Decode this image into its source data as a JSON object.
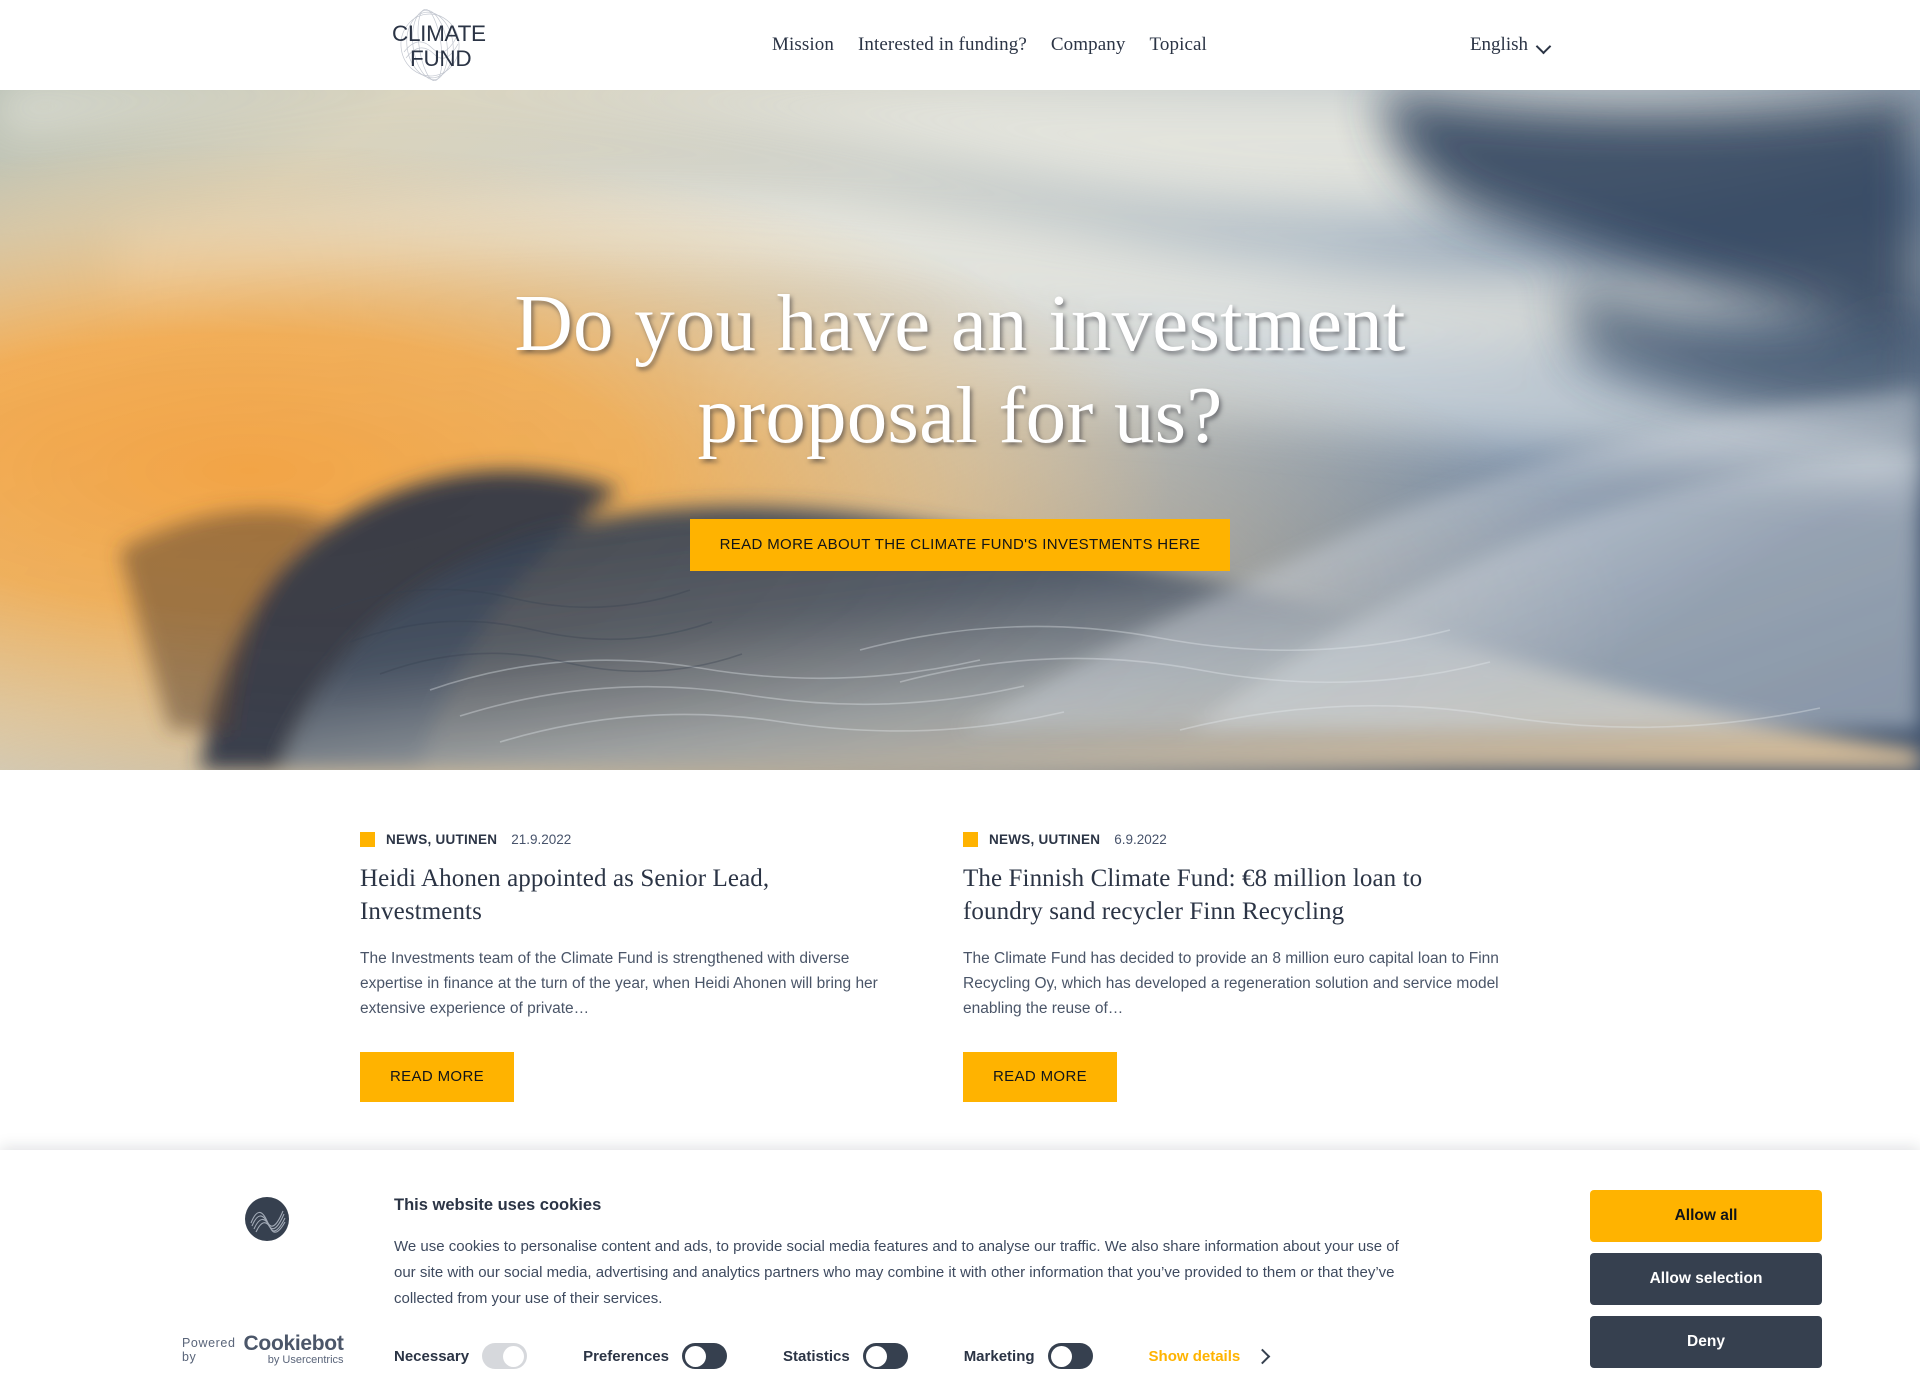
{
  "header": {
    "logo": {
      "line1": "CLIMATE",
      "line2": "FUND",
      "icon": "climate-fund-wave-logo"
    },
    "nav": [
      {
        "label": "Mission"
      },
      {
        "label": "Interested in funding?"
      },
      {
        "label": "Company"
      },
      {
        "label": "Topical"
      }
    ],
    "language": {
      "label": "English",
      "icon": "chevron-down-icon"
    }
  },
  "hero": {
    "title": "Do you have an investment proposal for us?",
    "cta_label": "READ MORE ABOUT THE CLIMATE FUND'S INVESTMENTS HERE",
    "accent_color": "#ffb300"
  },
  "news": [
    {
      "category": "NEWS, UUTINEN",
      "date": "21.9.2022",
      "title": "Heidi Ahonen appointed as Senior Lead, Investments",
      "excerpt": "The Investments team of the Climate Fund is strengthened with diverse expertise in finance at the turn of the year, when Heidi Ahonen will bring her extensive experience of private…",
      "button_label": "READ MORE"
    },
    {
      "category": "NEWS, UUTINEN",
      "date": "6.9.2022",
      "title": "The Finnish Climate Fund: €8 million loan to foundry sand recycler Finn Recycling",
      "excerpt": "The Climate Fund has decided to provide an 8 million euro capital loan to Finn Recycling Oy, which has developed a regeneration solution and service model enabling the reuse of…",
      "button_label": "READ MORE"
    }
  ],
  "cookie_banner": {
    "heading": "This website uses cookies",
    "body": "We use cookies to personalise content and ads, to provide social media features and to analyse our traffic. We also share information about your use of our site with our social media, advertising and analytics partners who may combine it with other information that you’ve provided to them or that they’ve collected from your use of their services.",
    "toggles": [
      {
        "label": "Necessary",
        "state": "locked"
      },
      {
        "label": "Preferences",
        "state": "off"
      },
      {
        "label": "Statistics",
        "state": "off"
      },
      {
        "label": "Marketing",
        "state": "off"
      }
    ],
    "show_details_label": "Show details",
    "show_details_icon": "chevron-right-icon",
    "buttons": {
      "allow_all": "Allow all",
      "allow_selection": "Allow selection",
      "deny": "Deny"
    },
    "powered_by": {
      "prefix": "Powered by",
      "brand": "Cookiebot",
      "sub": "by Usercentrics"
    },
    "badge_icon": "climate-fund-circle-logo",
    "accent_color": "#ffb300",
    "dark_color": "#36404f"
  }
}
